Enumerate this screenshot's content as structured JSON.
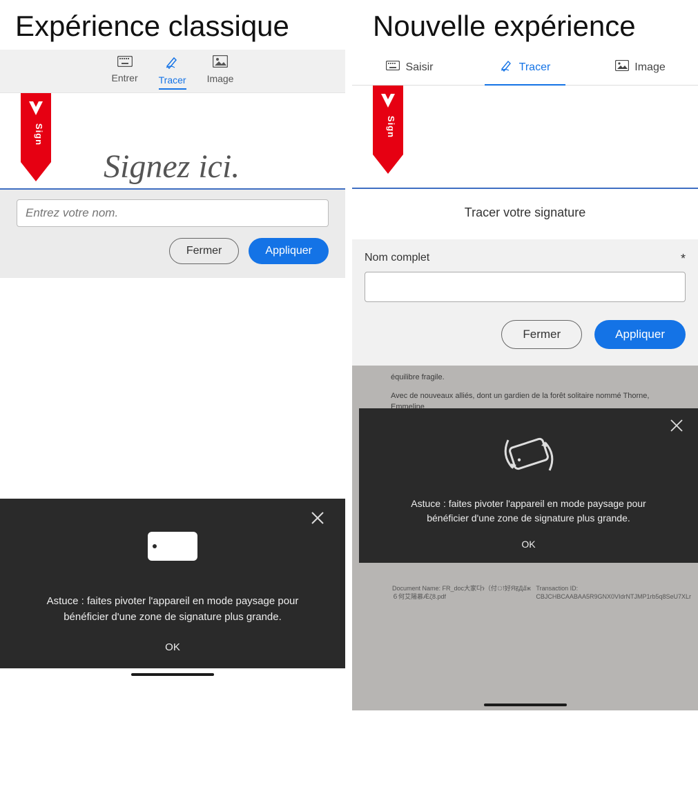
{
  "left": {
    "title": "Expérience classique",
    "tabs": {
      "entrer": "Entrer",
      "tracer": "Tracer",
      "image": "Image"
    },
    "sign_here": "Signez ici.",
    "name_placeholder": "Entrez votre nom.",
    "close_btn": "Fermer",
    "apply_btn": "Appliquer",
    "tip_text1": "Astuce : faites pivoter l'appareil en mode paysage pour",
    "tip_text2": "bénéficier d'une zone de signature plus grande.",
    "ok": "OK"
  },
  "right": {
    "title": "Nouvelle expérience",
    "tabs": {
      "saisir": "Saisir",
      "tracer": "Tracer",
      "image": "Image"
    },
    "instruction": "Tracer votre signature",
    "name_label": "Nom complet",
    "required": "*",
    "close_btn": "Fermer",
    "apply_btn": "Appliquer",
    "doc_line1": "équilibre fragile.",
    "doc_line2": "Avec de nouveaux alliés, dont un gardien de la forêt solitaire nommé Thorne, Emmeline",
    "doc_name_label": "Document Name: FR_doc大家다ነ（付া好ЯहДอัж６何艾陽慕Ǽζ8.pdf",
    "transaction_label": "Transaction ID: CBJCHBCAABAA5R9GNX0VIdrNTJMP1rb5q8SeU7XLr",
    "tip_text1": "Astuce : faites pivoter l'appareil en mode paysage pour",
    "tip_text2": "bénéficier d'une zone de signature plus grande.",
    "ok": "OK"
  }
}
